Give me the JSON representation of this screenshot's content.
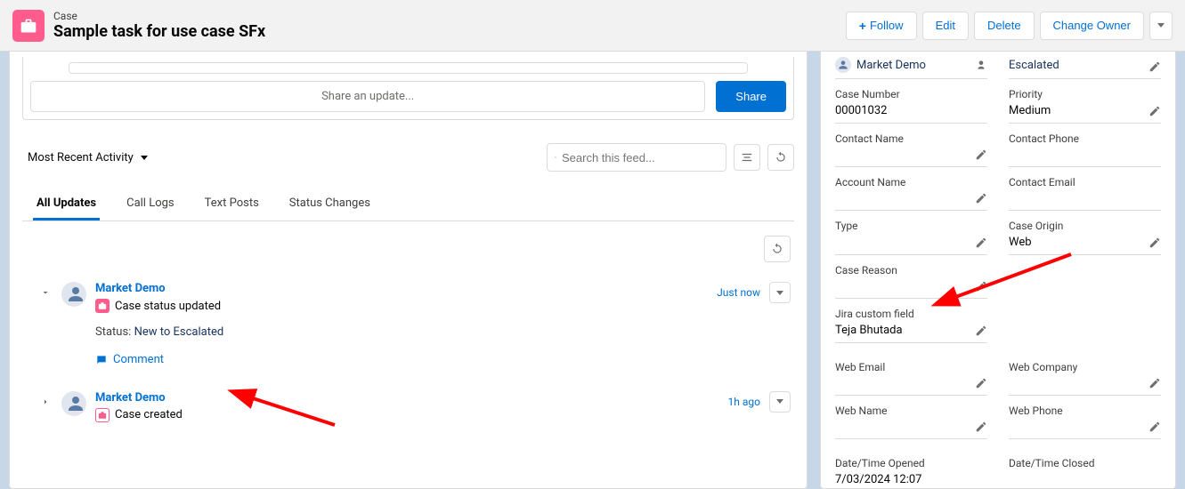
{
  "header": {
    "eyebrow": "Case",
    "title": "Sample task for use case SFx",
    "actions": {
      "follow": "Follow",
      "edit": "Edit",
      "delete": "Delete",
      "change_owner": "Change Owner"
    }
  },
  "feed": {
    "share_placeholder": "Share an update...",
    "share_button": "Share",
    "sort_label": "Most Recent Activity",
    "search_placeholder": "Search this feed...",
    "tabs": [
      "All Updates",
      "Call Logs",
      "Text Posts",
      "Status Changes"
    ],
    "active_tab": "All Updates",
    "items": [
      {
        "user": "Market Demo",
        "time": "Just now",
        "subline": "Case status updated",
        "status_label": "Status:",
        "status_value": "New to Escalated",
        "comment_label": "Comment",
        "expanded": true
      },
      {
        "user": "Market Demo",
        "time": "1h ago",
        "subline": "Case created",
        "expanded": false
      }
    ]
  },
  "details": {
    "owner": {
      "value": "Market Demo"
    },
    "status": {
      "value": "Escalated"
    },
    "case_number": {
      "label": "Case Number",
      "value": "00001032"
    },
    "priority": {
      "label": "Priority",
      "value": "Medium"
    },
    "contact_name": {
      "label": "Contact Name",
      "value": ""
    },
    "contact_phone": {
      "label": "Contact Phone",
      "value": ""
    },
    "account_name": {
      "label": "Account Name",
      "value": ""
    },
    "contact_email": {
      "label": "Contact Email",
      "value": ""
    },
    "type": {
      "label": "Type",
      "value": ""
    },
    "case_origin": {
      "label": "Case Origin",
      "value": "Web"
    },
    "case_reason": {
      "label": "Case Reason",
      "value": ""
    },
    "jira_custom": {
      "label": "Jira custom field",
      "value": "Teja Bhutada"
    },
    "web_email": {
      "label": "Web Email",
      "value": ""
    },
    "web_company": {
      "label": "Web Company",
      "value": ""
    },
    "web_name": {
      "label": "Web Name",
      "value": ""
    },
    "web_phone": {
      "label": "Web Phone",
      "value": ""
    },
    "datetime_opened": {
      "label": "Date/Time Opened",
      "value": "7/03/2024 12:07"
    },
    "datetime_closed": {
      "label": "Date/Time Closed",
      "value": ""
    }
  }
}
